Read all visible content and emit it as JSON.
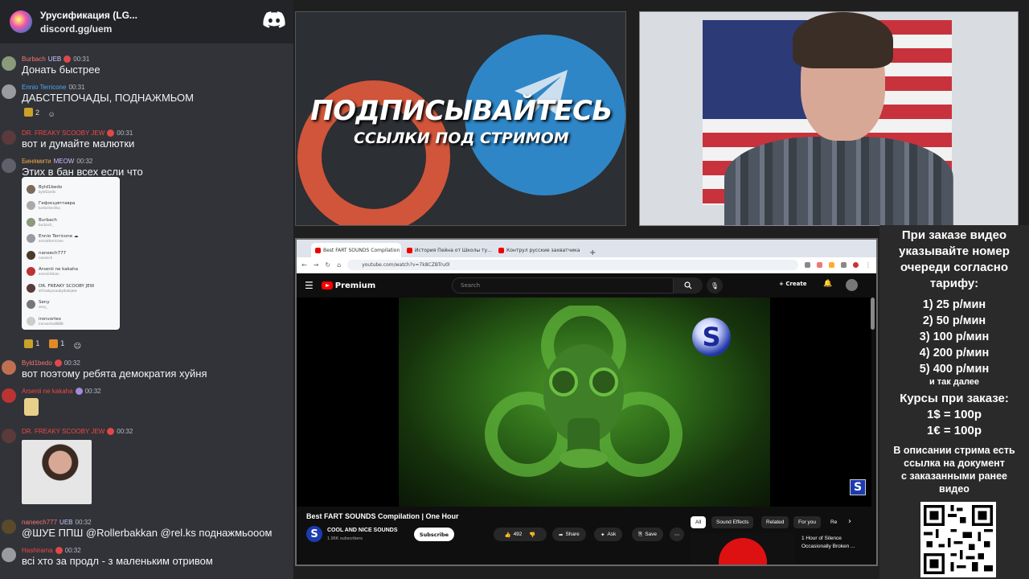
{
  "chat": {
    "server_name": "Урусификация (LG...",
    "server_invite": "discord.gg/uem",
    "messages": [
      {
        "user": "Burbach",
        "user_color": "#f57373",
        "tag": "UEB",
        "time": "00:31",
        "text": "Донать быстрее"
      },
      {
        "user": "Ennio Terricone",
        "user_color": "#4ea9f5",
        "time": "00:31",
        "text": "ДАБСТЕПОЧАДЫ, ПОДНАЖМЬОМ",
        "reactions": [
          "2",
          ""
        ]
      },
      {
        "user": "DR. FREAKY SCOOBY JEW",
        "user_color": "#f04747",
        "time": "00:31",
        "text": "вот и думайте малютки"
      },
      {
        "user": "Бинямити",
        "user_color": "#f0a848",
        "tag": "MEOW",
        "time": "00:32",
        "text": "Этих в бан всех если что",
        "reactions": [
          "1",
          "1",
          ""
        ]
      },
      {
        "user": "Byld1bedo",
        "user_color": "#f57373",
        "time": "00:32",
        "text": "вот поэтому ребята демократия хуйня"
      },
      {
        "user": "Arsenii ne kakaha",
        "user_color": "#f04747",
        "time": "00:32",
        "text": ""
      },
      {
        "user": "DR. FREAKY SCOOBY JEW",
        "user_color": "#f04747",
        "time": "00:32",
        "text": ""
      },
      {
        "user": "naneech777",
        "user_color": "#f57373",
        "tag": "UEB",
        "time": "00:32",
        "text": "@ШУЕ ППШ @Rollerbakkan @rel.ks поднажмьооом"
      },
      {
        "user": "Hashirama",
        "user_color": "#f04747",
        "time": "00:32",
        "text": "всі хто за продл - з маленьким      отривом"
      }
    ],
    "ban_list": [
      {
        "name": "Byld1bedo",
        "handle": "byld1bedo"
      },
      {
        "name": "Гефосциптавра",
        "handle": "kartoshechka"
      },
      {
        "name": "Burbach",
        "handle": "burbach_"
      },
      {
        "name": "Ennio Terricone ☁",
        "handle": "enniotterricone"
      },
      {
        "name": "naneech777",
        "handle": "naneech"
      },
      {
        "name": "Arsenii ne kakaha",
        "handle": "arsenii4ekan"
      },
      {
        "name": "DR. FREAKY SCOOBY JEW",
        "handle": "drfreakyscoobydodojew"
      },
      {
        "name": "Seny",
        "handle": "seny_"
      },
      {
        "name": "ironvortex",
        "handle": "ironvortex8888"
      }
    ]
  },
  "promo": {
    "title": "ПОДПИСЫВАЙТЕСЬ",
    "subtitle": "ССЫЛКИ ПОД СТРИМОМ"
  },
  "browser": {
    "tabs": [
      "Best FART SOUNDS Compilation",
      "История Пейна от Школы ту...",
      "Контрул русские захватчика"
    ],
    "new_tab": "+",
    "url": "youtube.com/watch?v=7k8CZBTru0l",
    "youtube": {
      "logo": "Premium",
      "search_placeholder": "Search",
      "create_label": "Create",
      "video_title": "Best FART SOUNDS Compilation | One Hour",
      "channel_name": "COOL AND NICE SOUNDS",
      "channel_subs": "1.96K subscribers",
      "subscribe_label": "Subscribe",
      "likes": "492",
      "share_label": "Share",
      "ask_label": "Ask",
      "save_label": "Save",
      "chips": [
        "All",
        "Sound Effects",
        "Related",
        "For you",
        "Re"
      ],
      "rec_title_1": "1 Hour of Silence",
      "rec_title_2": "Occasionally Broken ..."
    }
  },
  "info": {
    "header": [
      "При заказе видео",
      "указывайте номер",
      "очереди согласно",
      "тарифу:"
    ],
    "tiers": [
      "1) 25 р/мин",
      "2) 50 р/мин",
      "3) 100 р/мин",
      "4) 200 р/мин",
      "5) 400 р/мин"
    ],
    "etc": "и так далее",
    "courses": [
      "Курсы при заказе:",
      "1$ = 100р",
      "1€ = 100р"
    ],
    "note": [
      "В описании стрима есть",
      "ссылка на документ",
      "с заказанными ранее",
      "видео"
    ]
  },
  "colors": {
    "youtube_red": "#ff0000",
    "promo_orange": "#d1553a",
    "telegram_blue": "#2f86c7"
  }
}
